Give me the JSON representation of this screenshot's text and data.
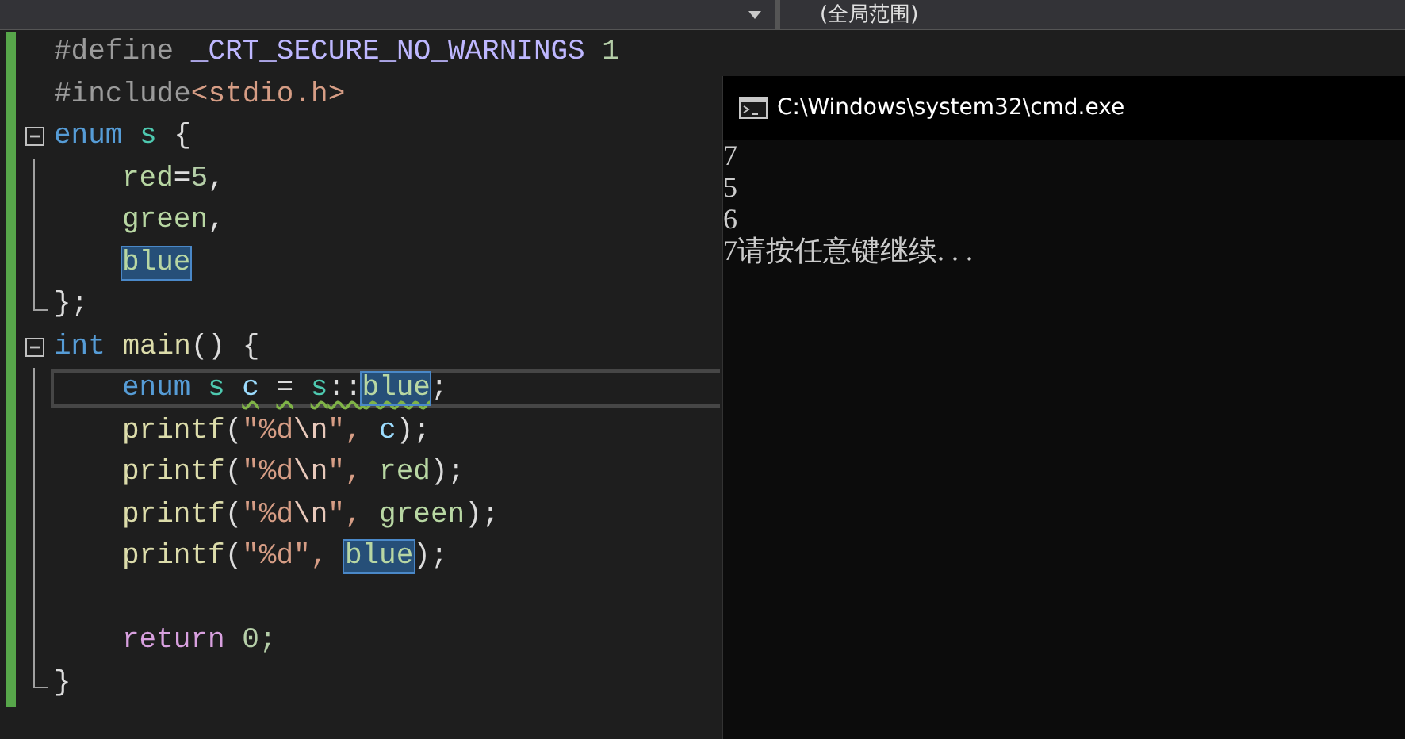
{
  "toolbar": {
    "scope_dropdown": "(全局范围)"
  },
  "editor": {
    "lines": [
      {
        "kind": "plain",
        "indented": false,
        "current": false,
        "tokens": [
          {
            "text": "#define",
            "kind": "preproc",
            "space": false,
            "highlighted": false,
            "squiggly": false
          },
          {
            "text": "_CRT_SECURE_NO_WARNINGS",
            "kind": "macro",
            "space": true,
            "highlighted": false,
            "squiggly": false
          },
          {
            "text": "1",
            "kind": "number",
            "space": true,
            "highlighted": false,
            "squiggly": false
          }
        ]
      },
      {
        "kind": "plain",
        "indented": false,
        "current": false,
        "tokens": [
          {
            "text": "#include",
            "kind": "preproc",
            "space": false,
            "highlighted": false,
            "squiggly": false
          },
          {
            "text": "<stdio.h>",
            "kind": "include",
            "space": false,
            "highlighted": false,
            "squiggly": false
          }
        ]
      },
      {
        "kind": "fold-start",
        "indented": false,
        "current": false,
        "tokens": [
          {
            "text": "enum",
            "kind": "keyword",
            "space": false,
            "highlighted": false,
            "squiggly": false
          },
          {
            "text": "s",
            "kind": "type",
            "space": true,
            "highlighted": false,
            "squiggly": false
          },
          {
            "text": "{",
            "kind": "plain",
            "space": true,
            "highlighted": false,
            "squiggly": false
          }
        ]
      },
      {
        "kind": "fold-inside",
        "indented": true,
        "current": false,
        "tokens": [
          {
            "text": "red",
            "kind": "enum",
            "space": false,
            "highlighted": false,
            "squiggly": false
          },
          {
            "text": "=",
            "kind": "plain",
            "space": false,
            "highlighted": false,
            "squiggly": false
          },
          {
            "text": "5",
            "kind": "number",
            "space": false,
            "highlighted": false,
            "squiggly": false
          },
          {
            "text": ",",
            "kind": "plain",
            "space": false,
            "highlighted": false,
            "squiggly": false
          }
        ]
      },
      {
        "kind": "fold-inside",
        "indented": true,
        "current": false,
        "tokens": [
          {
            "text": "green",
            "kind": "enum",
            "space": false,
            "highlighted": false,
            "squiggly": false
          },
          {
            "text": ",",
            "kind": "plain",
            "space": false,
            "highlighted": false,
            "squiggly": false
          }
        ]
      },
      {
        "kind": "fold-inside",
        "indented": true,
        "current": false,
        "tokens": [
          {
            "text": "blue",
            "kind": "enum",
            "space": false,
            "highlighted": true,
            "squiggly": false
          }
        ]
      },
      {
        "kind": "fold-end",
        "indented": false,
        "current": false,
        "tokens": [
          {
            "text": "};",
            "kind": "plain",
            "space": false,
            "highlighted": false,
            "squiggly": false
          }
        ]
      },
      {
        "kind": "fold-start",
        "indented": false,
        "current": false,
        "tokens": [
          {
            "text": "int",
            "kind": "keyword",
            "space": false,
            "highlighted": false,
            "squiggly": false
          },
          {
            "text": "main",
            "kind": "func",
            "space": true,
            "highlighted": false,
            "squiggly": false
          },
          {
            "text": "() {",
            "kind": "plain",
            "space": false,
            "highlighted": false,
            "squiggly": false
          }
        ]
      },
      {
        "kind": "fold-inside",
        "indented": true,
        "current": true,
        "tokens": [
          {
            "text": "enum",
            "kind": "keyword",
            "space": false,
            "highlighted": false,
            "squiggly": false
          },
          {
            "text": "s",
            "kind": "type",
            "space": true,
            "highlighted": false,
            "squiggly": false
          },
          {
            "text": "c",
            "kind": "local",
            "space": true,
            "highlighted": false,
            "squiggly": true
          },
          {
            "text": "=",
            "kind": "plain",
            "space": true,
            "highlighted": false,
            "squiggly": true
          },
          {
            "text": "s",
            "kind": "type",
            "space": true,
            "highlighted": false,
            "squiggly": true
          },
          {
            "text": "::",
            "kind": "plain",
            "space": false,
            "highlighted": false,
            "squiggly": true
          },
          {
            "text": "blue",
            "kind": "enum",
            "space": false,
            "highlighted": true,
            "squiggly": true
          },
          {
            "text": ";",
            "kind": "plain",
            "space": false,
            "highlighted": false,
            "squiggly": false
          }
        ]
      },
      {
        "kind": "fold-inside",
        "indented": true,
        "current": false,
        "tokens": [
          {
            "text": "printf",
            "kind": "func",
            "space": false,
            "highlighted": false,
            "squiggly": false
          },
          {
            "text": "(",
            "kind": "plain",
            "space": false,
            "highlighted": false,
            "squiggly": false
          },
          {
            "text": "\"%d",
            "kind": "string",
            "space": false,
            "highlighted": false,
            "squiggly": false
          },
          {
            "text": "\\n",
            "kind": "escape",
            "space": false,
            "highlighted": false,
            "squiggly": false
          },
          {
            "text": "\",",
            "kind": "string",
            "space": false,
            "highlighted": false,
            "squiggly": false
          },
          {
            "text": "c",
            "kind": "local",
            "space": true,
            "highlighted": false,
            "squiggly": false
          },
          {
            "text": ");",
            "kind": "plain",
            "space": false,
            "highlighted": false,
            "squiggly": false
          }
        ]
      },
      {
        "kind": "fold-inside",
        "indented": true,
        "current": false,
        "tokens": [
          {
            "text": "printf",
            "kind": "func",
            "space": false,
            "highlighted": false,
            "squiggly": false
          },
          {
            "text": "(",
            "kind": "plain",
            "space": false,
            "highlighted": false,
            "squiggly": false
          },
          {
            "text": "\"%d",
            "kind": "string",
            "space": false,
            "highlighted": false,
            "squiggly": false
          },
          {
            "text": "\\n",
            "kind": "escape",
            "space": false,
            "highlighted": false,
            "squiggly": false
          },
          {
            "text": "\",",
            "kind": "string",
            "space": false,
            "highlighted": false,
            "squiggly": false
          },
          {
            "text": "red",
            "kind": "enum",
            "space": true,
            "highlighted": false,
            "squiggly": false
          },
          {
            "text": ");",
            "kind": "plain",
            "space": false,
            "highlighted": false,
            "squiggly": false
          }
        ]
      },
      {
        "kind": "fold-inside",
        "indented": true,
        "current": false,
        "tokens": [
          {
            "text": "printf",
            "kind": "func",
            "space": false,
            "highlighted": false,
            "squiggly": false
          },
          {
            "text": "(",
            "kind": "plain",
            "space": false,
            "highlighted": false,
            "squiggly": false
          },
          {
            "text": "\"%d",
            "kind": "string",
            "space": false,
            "highlighted": false,
            "squiggly": false
          },
          {
            "text": "\\n",
            "kind": "escape",
            "space": false,
            "highlighted": false,
            "squiggly": false
          },
          {
            "text": "\",",
            "kind": "string",
            "space": false,
            "highlighted": false,
            "squiggly": false
          },
          {
            "text": "green",
            "kind": "enum",
            "space": true,
            "highlighted": false,
            "squiggly": false
          },
          {
            "text": ");",
            "kind": "plain",
            "space": false,
            "highlighted": false,
            "squiggly": false
          }
        ]
      },
      {
        "kind": "fold-inside",
        "indented": true,
        "current": false,
        "tokens": [
          {
            "text": "printf",
            "kind": "func",
            "space": false,
            "highlighted": false,
            "squiggly": false
          },
          {
            "text": "(",
            "kind": "plain",
            "space": false,
            "highlighted": false,
            "squiggly": false
          },
          {
            "text": "\"%d\",",
            "kind": "string",
            "space": false,
            "highlighted": false,
            "squiggly": false
          },
          {
            "text": "blue",
            "kind": "enum",
            "space": true,
            "highlighted": true,
            "squiggly": false
          },
          {
            "text": ");",
            "kind": "plain",
            "space": false,
            "highlighted": false,
            "squiggly": false
          }
        ]
      },
      {
        "kind": "fold-inside",
        "current": false
      },
      {
        "kind": "fold-inside",
        "indented": true,
        "current": false,
        "tokens": [
          {
            "text": "return",
            "kind": "control",
            "space": false,
            "highlighted": false,
            "squiggly": false
          },
          {
            "text": "0;",
            "kind": "number",
            "space": true,
            "highlighted": false,
            "squiggly": false
          }
        ]
      },
      {
        "kind": "fold-end",
        "indented": false,
        "current": false,
        "tokens": [
          {
            "text": "}",
            "kind": "plain",
            "space": false,
            "highlighted": false,
            "squiggly": false
          }
        ]
      }
    ]
  },
  "console_window": {
    "title": "C:\\Windows\\system32\\cmd.exe",
    "output": [
      "7",
      "5",
      "6",
      "7请按任意键继续. . ."
    ]
  }
}
